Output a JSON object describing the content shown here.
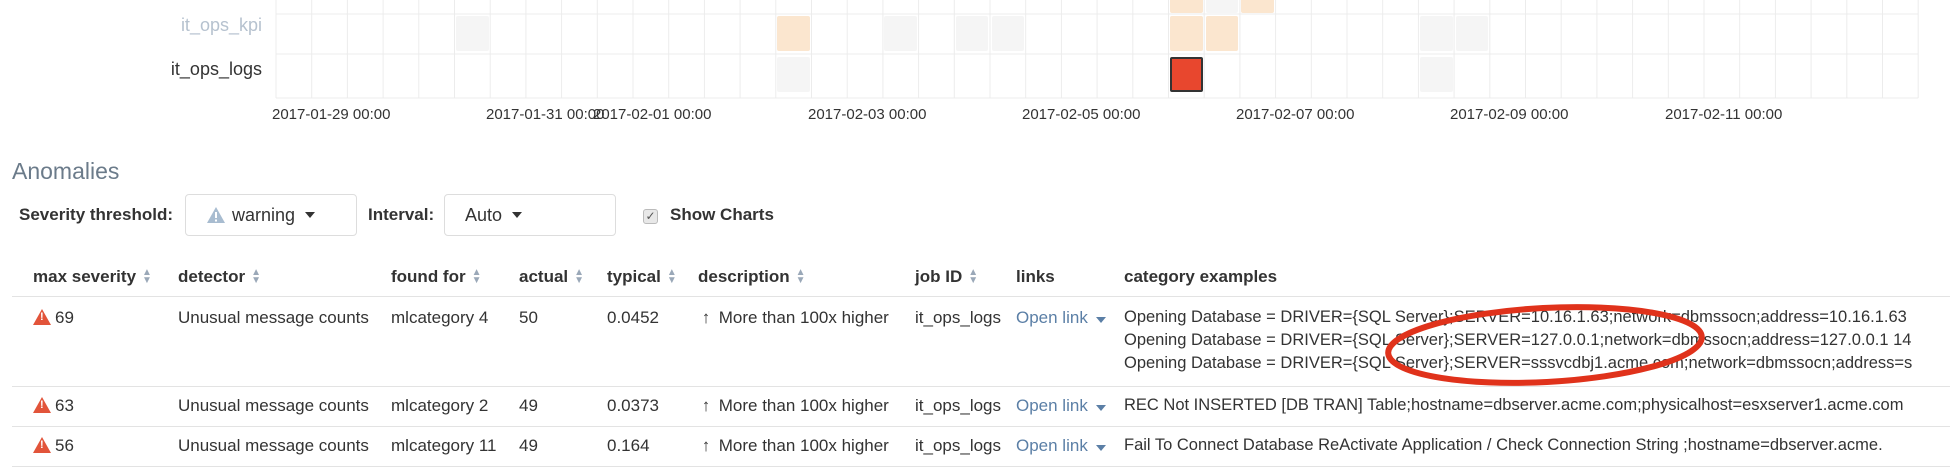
{
  "swimlane": {
    "lanes": [
      "it_ops_kpi",
      "it_ops_logs"
    ],
    "x_ticks": [
      "2017-01-29 00:00",
      "2017-01-31 00:00",
      "2017-02-01 00:00",
      "2017-02-03 00:00",
      "2017-02-05 00:00",
      "2017-02-07 00:00",
      "2017-02-09 00:00",
      "2017-02-11 00:00"
    ],
    "colors": {
      "warning_light": "#fbe6cf",
      "critical": "#e8472e",
      "none": "#f5f5f5"
    }
  },
  "anomalies": {
    "title": "Anomalies",
    "severity_threshold_label": "Severity threshold:",
    "severity_value": "warning",
    "interval_label": "Interval:",
    "interval_value": "Auto",
    "show_charts_label": "Show Charts",
    "show_charts_checked": true,
    "columns": [
      "max severity",
      "detector",
      "found for",
      "actual",
      "typical",
      "description",
      "job ID",
      "links",
      "category examples"
    ],
    "rows": [
      {
        "severity": "69",
        "detector": "Unusual message counts",
        "found_for": "mlcategory 4",
        "actual": "50",
        "typical": "0.0452",
        "description": "More than 100x higher",
        "job_id": "it_ops_logs",
        "link": "Open link",
        "examples": [
          "Opening Database = DRIVER={SQL Server};SERVER=10.16.1.63;network=dbmssocn;address=10.16.1.63",
          "Opening Database = DRIVER={SQL Server};SERVER=127.0.0.1;network=dbmssocn;address=127.0.0.1 14",
          "Opening Database = DRIVER={SQL Server};SERVER=sssvcdbj1.acme.com;network=dbmssocn;address=s"
        ]
      },
      {
        "severity": "63",
        "detector": "Unusual message counts",
        "found_for": "mlcategory 2",
        "actual": "49",
        "typical": "0.0373",
        "description": "More than 100x higher",
        "job_id": "it_ops_logs",
        "link": "Open link",
        "examples": [
          "REC Not INSERTED [DB TRAN] Table;hostname=dbserver.acme.com;physicalhost=esxserver1.acme.com"
        ]
      },
      {
        "severity": "56",
        "detector": "Unusual message counts",
        "found_for": "mlcategory 11",
        "actual": "49",
        "typical": "0.164",
        "description": "More than 100x higher",
        "job_id": "it_ops_logs",
        "link": "Open link",
        "examples": [
          "Fail To Connect Database ReActivate Application / Check Connection String ;hostname=dbserver.acme."
        ]
      }
    ]
  }
}
